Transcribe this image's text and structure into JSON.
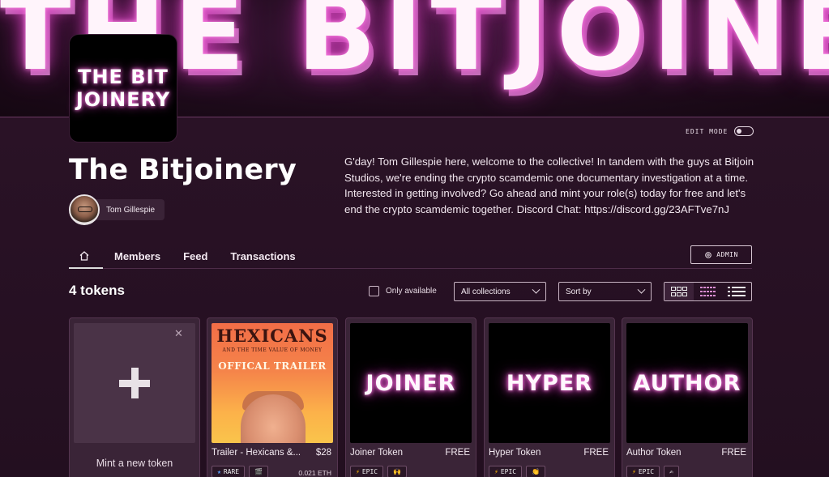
{
  "banner": {
    "text": "THE BITJOINERY"
  },
  "logo": {
    "line1": "THE BIT",
    "line2": "JOINERY"
  },
  "edit_mode": {
    "label": "EDIT MODE"
  },
  "collection": {
    "title": "The Bitjoinery",
    "owner": "Tom Gillespie",
    "description": "G'day! Tom Gillespie here, welcome to the collective! In tandem with the guys at Bitjoin Studios, we're ending the crypto scamdemic one documentary investigation at a time. Interested in getting involved? Go ahead and mint your role(s) today for free and let's end the crypto scamdemic together.  Discord Chat: https://discord.gg/23AFTve7nJ"
  },
  "tabs": [
    {
      "label": "Members"
    },
    {
      "label": "Feed"
    },
    {
      "label": "Transactions"
    }
  ],
  "admin_button": {
    "label": "ADMIN"
  },
  "toolbar": {
    "token_count": "4 tokens",
    "only_available": "Only available",
    "collections_select": "All collections",
    "sort_select": "Sort by"
  },
  "mint_card": {
    "label": "Mint a new token"
  },
  "tokens": [
    {
      "name": "Trailer - Hexicans &...",
      "price": "$28",
      "eth": "0.021 ETH",
      "rarity": "RARE",
      "rarity_icon": "star",
      "extra_icon": "clapperboard",
      "image": {
        "title": "HEXICANS",
        "subtitle": "AND THE TIME VALUE OF MONEY",
        "caption": "OFFICAL TRAILER"
      }
    },
    {
      "name": "Joiner Token",
      "price": "FREE",
      "rarity": "EPIC",
      "rarity_icon": "lightning",
      "extra_icon": "raised-hands",
      "image": {
        "word": "JOINER"
      }
    },
    {
      "name": "Hyper Token",
      "price": "FREE",
      "rarity": "EPIC",
      "rarity_icon": "lightning",
      "extra_icon": "clapping-hands",
      "image": {
        "word": "HYPER"
      }
    },
    {
      "name": "Author Token",
      "price": "FREE",
      "rarity": "EPIC",
      "rarity_icon": "lightning",
      "extra_icon": "writing-hand",
      "image": {
        "word": "AUTHOR"
      }
    }
  ],
  "colors": {
    "background": "#24101f",
    "neon": "#e04fc8",
    "card": "#3a2437"
  }
}
